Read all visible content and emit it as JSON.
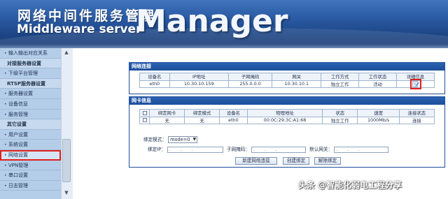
{
  "header": {
    "title_cn": "网络中间件服务管理",
    "title_en": "Middleware server",
    "title_big": "Manager"
  },
  "sidebar": {
    "items": [
      {
        "label": "输入输出对应关系",
        "group": false,
        "active": false
      },
      {
        "label": "对接服务器设置",
        "group": true,
        "active": false
      },
      {
        "label": "下级平台管理",
        "group": false,
        "active": false
      },
      {
        "label": "RTSP服务器设置",
        "group": true,
        "active": false
      },
      {
        "label": "服务器设置",
        "group": false,
        "active": false
      },
      {
        "label": "设备信息",
        "group": false,
        "active": false
      },
      {
        "label": "服务管理",
        "group": false,
        "active": false
      },
      {
        "label": "其它设置",
        "group": true,
        "active": false
      },
      {
        "label": "用户设置",
        "group": false,
        "active": false
      },
      {
        "label": "系统设置",
        "group": false,
        "active": false
      },
      {
        "label": "网络设置",
        "group": false,
        "active": true
      },
      {
        "label": "VPN管理",
        "group": false,
        "active": false
      },
      {
        "label": "串口设置",
        "group": false,
        "active": false
      },
      {
        "label": "日志管理",
        "group": false,
        "active": false
      }
    ]
  },
  "network_connection": {
    "title": "网络连接",
    "headers": [
      "设备名",
      "IP地址",
      "子网掩码",
      "网关",
      "工作方式",
      "工作状态",
      "详细信息"
    ],
    "rows": [
      [
        "eth0",
        "10.30.10.159",
        "255.0.0.0",
        "10.30.10.1",
        "独立工作",
        "活动"
      ]
    ]
  },
  "nic_info": {
    "title": "网卡信息",
    "headers": [
      "",
      "绑定网卡",
      "绑定模式",
      "设备名",
      "物理地址",
      "状态",
      "速度",
      "连接状态"
    ],
    "rows": [
      [
        "",
        "无",
        "无",
        "eth0",
        "00:0C:29:3C:A1:68",
        "独立工作",
        "1000Mb/s",
        "连接"
      ]
    ]
  },
  "bind_form": {
    "mode_label": "绑定模式：",
    "mode_value": "mode=0",
    "ip_label": "绑定IP：",
    "mask_label": "子网掩码：",
    "gateway_label": "默认网关：",
    "ip_placeholder": ". . ."
  },
  "buttons": {
    "new_connection": "新建网络连接",
    "create_bind": "创建绑定",
    "remove_bind": "解除绑定"
  },
  "watermark": "头条 @智能化弱电工程分享",
  "colors": {
    "banner": "#2a5aa3",
    "sidebar": "#b4cde8",
    "panel_header": "#1d4f9b",
    "highlight": "#e0201e"
  }
}
